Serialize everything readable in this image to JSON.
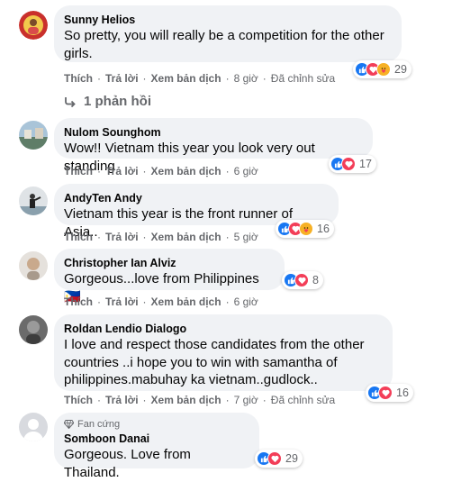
{
  "actions": {
    "like": "Thích",
    "reply": "Trả lời",
    "translate": "Xem bản dịch"
  },
  "comments": [
    {
      "name": "Sunny Helios",
      "lines": [
        "So pretty, you will really be a competition for the other",
        "girls."
      ],
      "time": "8 giờ",
      "edited": "Đã chỉnh sửa",
      "reaction_count": "29",
      "reactions": [
        "like-icon",
        "love-icon",
        "care-icon"
      ]
    },
    {
      "name": "Nulom Sounghom",
      "lines": [
        "Wow!! Vietnam this year you look very out standing"
      ],
      "time": "6 giờ",
      "reaction_count": "17",
      "reactions": [
        "like-icon",
        "love-icon"
      ]
    },
    {
      "name": "AndyTen Andy",
      "lines": [
        "Vietnam this year is the front runner of Asia.."
      ],
      "time": "5 giờ",
      "reaction_count": "16",
      "reactions": [
        "like-icon",
        "love-icon",
        "care-icon"
      ]
    },
    {
      "name": "Christopher Ian Alviz",
      "lines": [
        "Gorgeous...love from Philippines 🇵🇭"
      ],
      "time": "6 giờ",
      "reaction_count": "8",
      "reactions": [
        "like-icon",
        "love-icon"
      ]
    },
    {
      "name": "Roldan Lendio Dialogo",
      "lines": [
        "I love and respect those candidates from the other",
        "countries ..i hope you to win with samantha of",
        "philippines.mabuhay ka vietnam..gudlock.."
      ],
      "time": "7 giờ",
      "edited": "Đã chỉnh sửa",
      "reaction_count": "16",
      "reactions": [
        "like-icon",
        "love-icon"
      ]
    },
    {
      "badge": "Fan cứng",
      "name": "Somboon Danai",
      "lines": [
        "Gorgeous. Love from Thailand."
      ],
      "reaction_count": "29",
      "reactions": [
        "like-icon",
        "love-icon"
      ]
    }
  ],
  "replies_link": "1 phản hồi",
  "colors": {
    "like": "#1877f2",
    "love": "#f33e58",
    "care": "#f7b125",
    "bubble": "#f0f2f5",
    "meta": "#65676b"
  }
}
